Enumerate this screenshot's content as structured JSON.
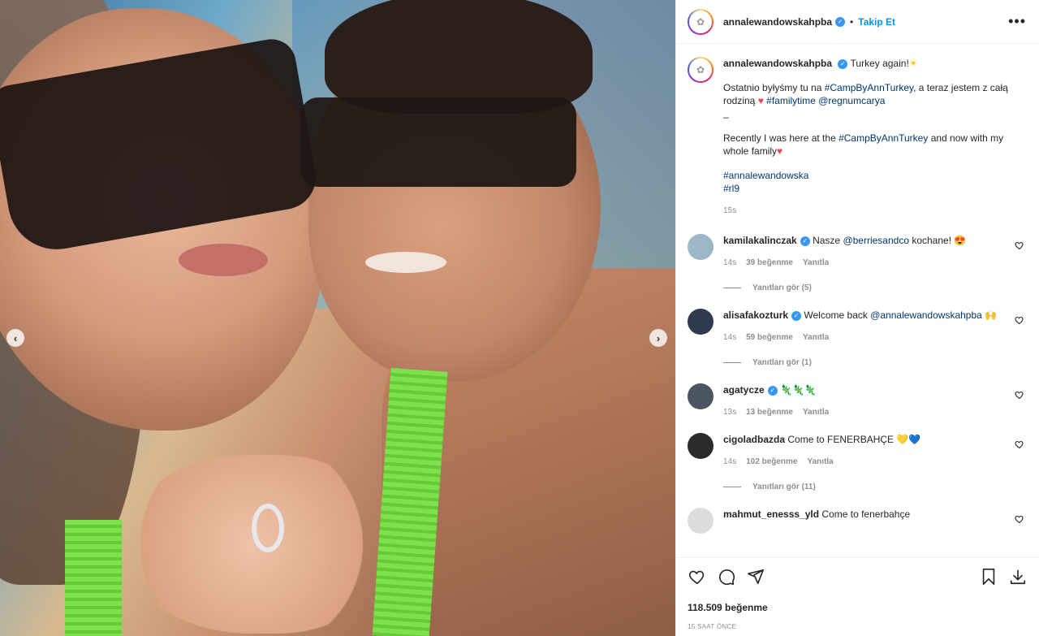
{
  "post": {
    "author": "annalewandowskahpba",
    "follow_label": "Takip Et",
    "separator": "•",
    "more_label": "•••",
    "caption_username": "annalewandowskahpba",
    "caption_title": "Turkey again!",
    "caption_l1_pre": "Ostatnio byłyśmy tu na ",
    "caption_l1_tag": "#CampByAnnTurkey",
    "caption_l1_post": ", a teraz jestem z całą rodziną ",
    "caption_l2_tag": "#familytime",
    "caption_l2_mention": "@regnumcarya",
    "caption_dash": "–",
    "caption_en_pre": "Recently I was here at the ",
    "caption_en_tag": "#CampByAnnTurkey",
    "caption_en_post": " and now with my whole family",
    "tag1": "#annalewandowska",
    "tag2": "#rl9",
    "caption_time": "15s",
    "likes": "118.509 beğenme",
    "ago": "15 SAAT ÖNCE"
  },
  "comments": [
    {
      "user": "kamilakalinczak",
      "verified": true,
      "pre": "Nasze ",
      "mention": "@berriesandco",
      "post": " kochane! 😍",
      "time": "14s",
      "likes": "39 beğenme",
      "reply": "Yanıtla",
      "replies": "Yanıtları gör (5)",
      "avatar_color": "#9db7c9"
    },
    {
      "user": "alisafakozturk",
      "verified": true,
      "pre": "Welcome back ",
      "mention": "@annalewandowskahpba",
      "post": " 🙌",
      "time": "14s",
      "likes": "59 beğenme",
      "reply": "Yanıtla",
      "replies": "Yanıtları gör (1)",
      "avatar_color": "#2e3a4f"
    },
    {
      "user": "agatycze",
      "verified": true,
      "pre": "",
      "mention": "",
      "post": "🦎🦎🦎",
      "time": "13s",
      "likes": "13 beğenme",
      "reply": "Yanıtla",
      "replies": "",
      "avatar_color": "#4a5560"
    },
    {
      "user": "cigoladbazda",
      "verified": false,
      "pre": "Come to FENERBAHÇE ",
      "mention": "",
      "post": "💛💙",
      "time": "14s",
      "likes": "102 beğenme",
      "reply": "Yanıtla",
      "replies": "Yanıtları gör (11)",
      "avatar_color": "#2b2b2b"
    },
    {
      "user": "mahmut_enesss_yld",
      "verified": false,
      "pre": "Come to fenerbahçe",
      "mention": "",
      "post": "",
      "time": "",
      "likes": "",
      "reply": "",
      "replies": "",
      "avatar_color": "#dcdcdc"
    }
  ],
  "icons": [
    "heart-icon",
    "comment-icon",
    "share-icon",
    "bookmark-icon",
    "download-icon"
  ],
  "colors": {
    "accent": "#0095f6",
    "verified": "#3897f0",
    "text": "#262626",
    "muted": "#8e8e8e"
  }
}
